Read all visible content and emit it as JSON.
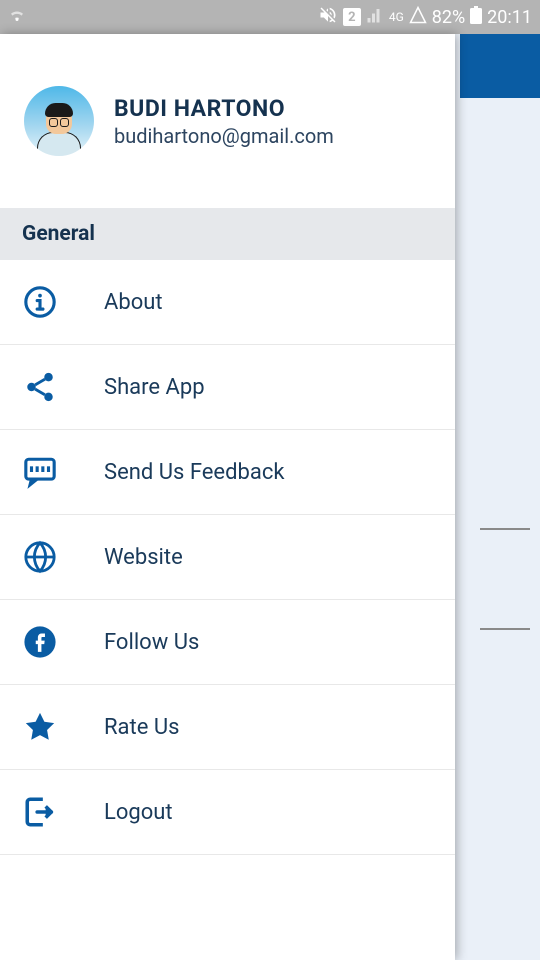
{
  "status": {
    "sim": "2",
    "network": "4G",
    "battery": "82%",
    "time": "20:11"
  },
  "profile": {
    "name": "BUDI HARTONO",
    "email": "budihartono@gmail.com"
  },
  "section_header": "General",
  "menu": [
    {
      "label": "About"
    },
    {
      "label": "Share App"
    },
    {
      "label": "Send Us Feedback"
    },
    {
      "label": "Website"
    },
    {
      "label": "Follow Us"
    },
    {
      "label": "Rate Us"
    },
    {
      "label": "Logout"
    }
  ]
}
